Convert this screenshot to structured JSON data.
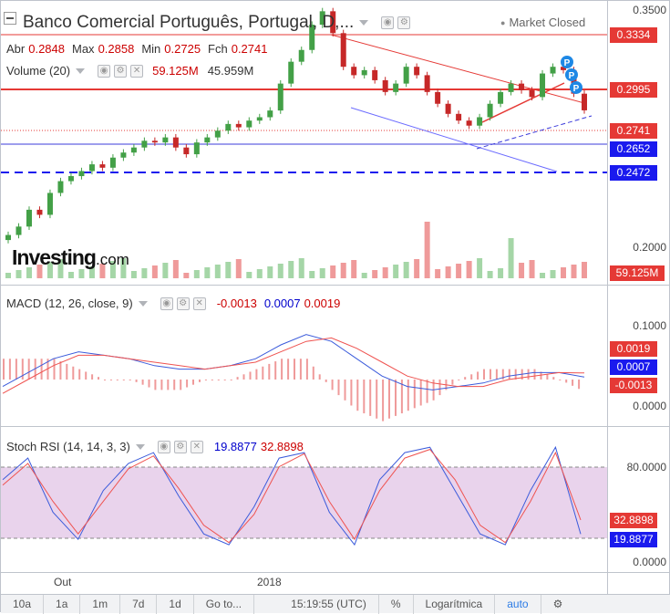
{
  "chart_title": "Banco Comercial Português, Portugal, D,...",
  "market_status": "Market Closed",
  "ohlc": {
    "open_label": "Abr",
    "open": "0.2848",
    "high_label": "Max",
    "high": "0.2858",
    "low_label": "Min",
    "low": "0.2725",
    "close_label": "Fch",
    "close": "0.2741"
  },
  "volume_legend": {
    "name": "Volume (20)",
    "v1": "59.125M",
    "v2": "45.959M"
  },
  "macd_legend": {
    "name": "MACD (12, 26, close, 9)",
    "v1": "-0.0013",
    "v2": "0.0007",
    "v3": "0.0019"
  },
  "stoch_legend": {
    "name": "Stoch RSI (14, 14, 3, 3)",
    "v1": "19.8877",
    "v2": "32.8898"
  },
  "logo": {
    "main": "Investing",
    "suffix": ".com"
  },
  "price_axis": {
    "ticks": [
      "0.3500",
      "0.2000"
    ],
    "tags": [
      {
        "label": "0.3334",
        "color": "#e53935"
      },
      {
        "label": "0.2995",
        "color": "#e53935"
      },
      {
        "label": "0.2741",
        "color": "#e53935"
      },
      {
        "label": "0.2652",
        "color": "#1a1aee"
      },
      {
        "label": "0.2472",
        "color": "#1a1aee"
      },
      {
        "label": "59.125M",
        "color": "#e53935"
      }
    ]
  },
  "macd_axis": {
    "ticks": [
      "0.1000",
      "0.0000"
    ],
    "tags": [
      {
        "label": "0.0019",
        "color": "#e53935"
      },
      {
        "label": "0.0007",
        "color": "#1a1aee"
      },
      {
        "label": "-0.0013",
        "color": "#e53935"
      }
    ]
  },
  "stoch_axis": {
    "ticks": [
      "80.0000",
      "0.0000"
    ],
    "tags": [
      {
        "label": "32.8898",
        "color": "#e53935"
      },
      {
        "label": "19.8877",
        "color": "#1a1aee"
      }
    ]
  },
  "x_labels": [
    "Out",
    "2018"
  ],
  "toolbar": {
    "items": [
      "10a",
      "1a",
      "1m",
      "7d",
      "1d",
      "Go to...",
      "15:19:55 (UTC)",
      "%",
      "Logarítmica",
      "auto"
    ]
  },
  "colors": {
    "up": "#43a047",
    "down": "#c62828",
    "macd": "#3b5bdb",
    "signal": "#ef5350",
    "stoch_band": "#e1c4e6"
  },
  "icons": [
    "settings-icon",
    "eye-icon",
    "close-icon",
    "gear-icon",
    "chevron-down-icon"
  ],
  "chart_data": [
    {
      "type": "candlestick",
      "title": "Banco Comercial Português, Portugal, D",
      "x_ticks": [
        "Out",
        "2018"
      ],
      "y_ticks": [
        0.35,
        0.2
      ],
      "ylim": [
        0.19,
        0.35
      ],
      "horizontal_levels": [
        0.3334,
        0.2995,
        0.2741,
        0.2652,
        0.2472
      ],
      "close_series": [
        0.2,
        0.205,
        0.215,
        0.212,
        0.225,
        0.232,
        0.235,
        0.238,
        0.242,
        0.24,
        0.246,
        0.249,
        0.252,
        0.256,
        0.255,
        0.258,
        0.252,
        0.248,
        0.255,
        0.258,
        0.262,
        0.266,
        0.264,
        0.268,
        0.27,
        0.274,
        0.29,
        0.303,
        0.31,
        0.325,
        0.333,
        0.32,
        0.3,
        0.295,
        0.298,
        0.292,
        0.285,
        0.29,
        0.3,
        0.295,
        0.285,
        0.278,
        0.272,
        0.268,
        0.265,
        0.27,
        0.278,
        0.285,
        0.29,
        0.286,
        0.282,
        0.296,
        0.3,
        0.298,
        0.284,
        0.2741
      ]
    },
    {
      "type": "line",
      "title": "MACD (12, 26, close, 9)",
      "y_ticks": [
        0.1,
        0.0
      ],
      "series": [
        {
          "name": "MACD",
          "values": [
            -0.002,
            0.002,
            0.006,
            0.008,
            0.007,
            0.006,
            0.004,
            0.003,
            0.003,
            0.004,
            0.006,
            0.01,
            0.013,
            0.011,
            0.006,
            0.001,
            -0.002,
            -0.003,
            -0.002,
            -0.001,
            0.001,
            0.002,
            0.002,
            0.0007
          ]
        },
        {
          "name": "Signal",
          "values": [
            -0.004,
            0.0,
            0.004,
            0.007,
            0.007,
            0.006,
            0.005,
            0.004,
            0.003,
            0.004,
            0.005,
            0.008,
            0.011,
            0.012,
            0.009,
            0.005,
            0.001,
            -0.001,
            -0.002,
            -0.002,
            0.0,
            0.001,
            0.002,
            0.0019
          ]
        }
      ]
    },
    {
      "type": "line",
      "title": "Stoch RSI (14, 14, 3, 3)",
      "y_ticks": [
        80,
        0
      ],
      "band": [
        20,
        80
      ],
      "series": [
        {
          "name": "K",
          "values": [
            70,
            90,
            40,
            15,
            60,
            85,
            95,
            55,
            20,
            10,
            45,
            90,
            95,
            40,
            10,
            70,
            95,
            100,
            60,
            20,
            10,
            60,
            100,
            19.8877
          ]
        },
        {
          "name": "D",
          "values": [
            65,
            85,
            50,
            20,
            50,
            80,
            92,
            62,
            28,
            12,
            38,
            82,
            94,
            50,
            15,
            60,
            90,
            98,
            70,
            28,
            12,
            50,
            95,
            32.8898
          ]
        }
      ]
    }
  ]
}
